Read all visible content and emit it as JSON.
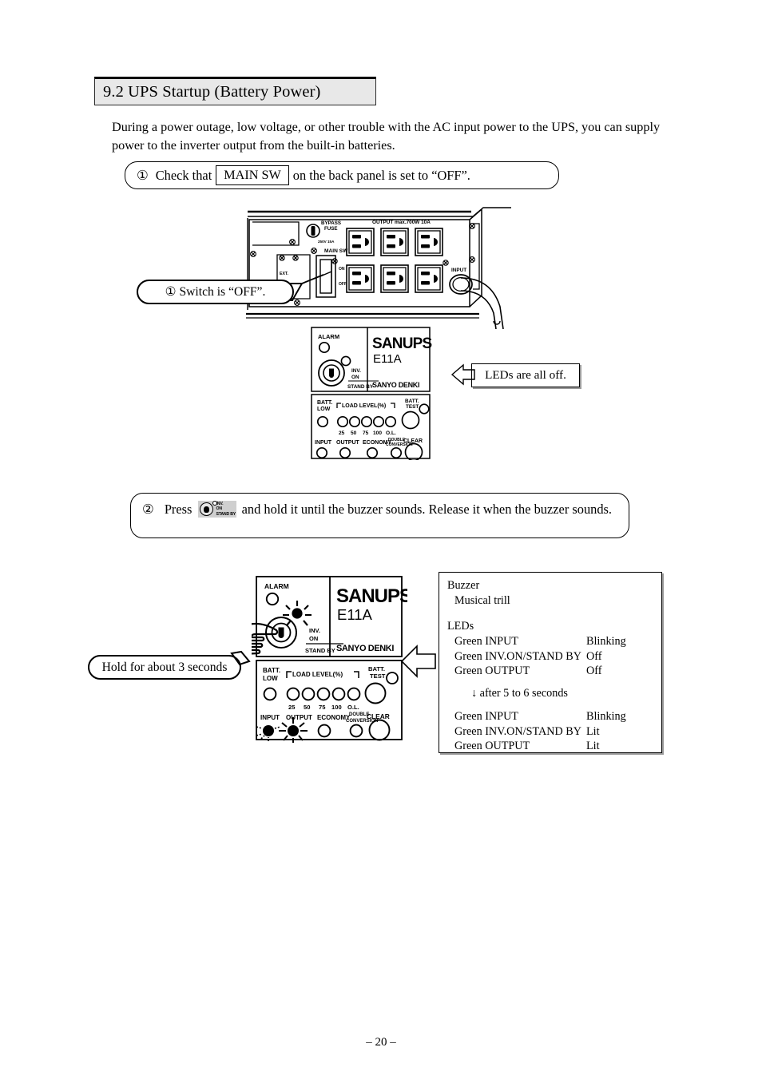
{
  "document": {
    "page_number": "– 20 –"
  },
  "section": {
    "heading": "9.2 UPS Startup (Battery Power)",
    "intro": "During a power outage, low voltage, or other trouble with the AC input power to the UPS, you can supply power to the inverter output from the built-in batteries."
  },
  "steps": {
    "step1": {
      "number": "①",
      "text_before": "Check that",
      "boxed_label": "MAIN SW",
      "text_after": "on the back panel is set to “OFF”."
    },
    "step2": {
      "number": "②",
      "text_before": "Press",
      "button_icon_labels": {
        "line1": "INV.",
        "line2": "ON",
        "line3": "STAND BY"
      },
      "text_after": "and hold it until the buzzer sounds. Release it when the buzzer sounds."
    }
  },
  "callouts": {
    "switch_off": "① Switch is “OFF”.",
    "leds_all_off": "LEDs are all off.",
    "hold_3_seconds": "Hold for about 3 seconds"
  },
  "back_panel": {
    "bypass_fuse": "BYPASS FUSE",
    "fuse_rating": "250V 15A",
    "main_sw": "MAIN SW",
    "main_sw_on": "ON",
    "main_sw_off": "OFF",
    "output_label": "OUTPUT max.700W 10A",
    "input_label": "INPUT",
    "ext_label": "EXT."
  },
  "led_panel": {
    "alarm": "ALARM",
    "brand": "SANUPS",
    "model": "E11A",
    "maker": "SANYO DENKI",
    "inv_on": {
      "line1": "INV.",
      "line2": "ON",
      "line3": "STAND BY"
    },
    "batt_low": {
      "line1": "BATT.",
      "line2": "LOW"
    },
    "load_level": "LOAD LEVEL(%)",
    "load_ticks": [
      "25",
      "50",
      "75",
      "100",
      "O.L."
    ],
    "status_leds": [
      "INPUT",
      "OUTPUT",
      "ECONOMY"
    ],
    "double_conversion": {
      "line1": "DOUBLE",
      "line2": "CONVERSION"
    },
    "batt_test": {
      "line1": "BATT.",
      "line2": "TEST"
    },
    "clear": "CLEAR"
  },
  "status_box": {
    "buzzer_title": "Buzzer",
    "buzzer_value": "Musical trill",
    "leds_title": "LEDs",
    "phase1": [
      {
        "led": "Green INPUT",
        "state": "Blinking"
      },
      {
        "led": "Green INV.ON/STAND BY",
        "state": "Off"
      },
      {
        "led": "Green OUTPUT",
        "state": "Off"
      }
    ],
    "transition": "↓   after 5 to 6 seconds",
    "phase2": [
      {
        "led": "Green INPUT",
        "state": "Blinking"
      },
      {
        "led": "Green INV.ON/STAND BY",
        "state": "Lit"
      },
      {
        "led": "Green OUTPUT",
        "state": "Lit"
      }
    ]
  }
}
